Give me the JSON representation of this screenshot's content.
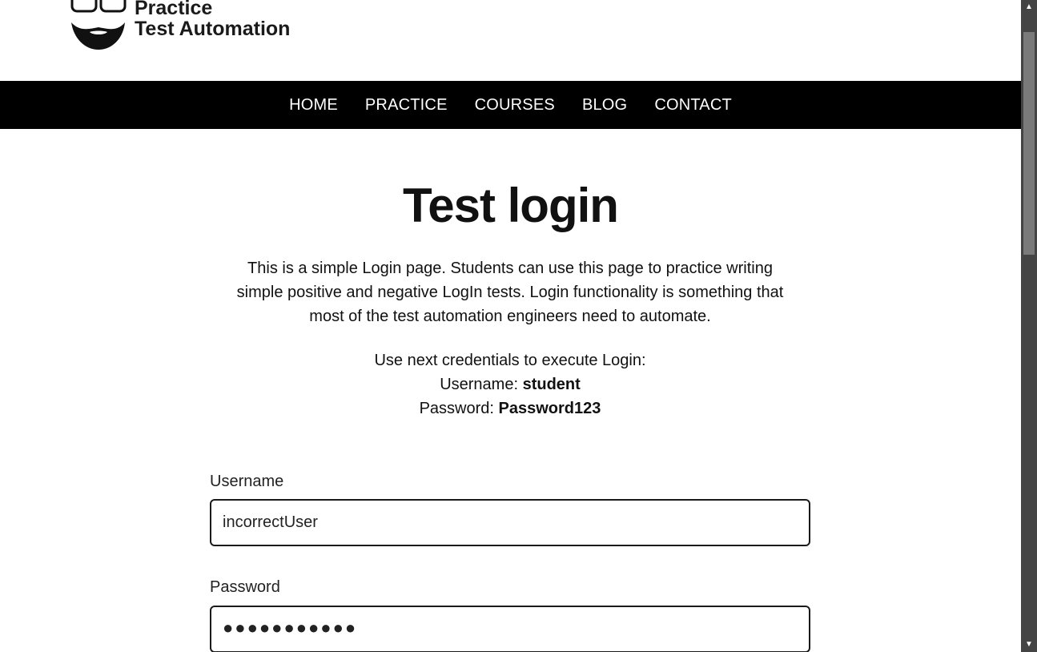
{
  "logo": {
    "line1": "Practice",
    "line2": "Test Automation",
    "icon": "bearded-face-icon"
  },
  "nav": {
    "items": [
      "HOME",
      "PRACTICE",
      "COURSES",
      "BLOG",
      "CONTACT"
    ]
  },
  "main": {
    "title": "Test login",
    "intro": "This is a simple Login page. Students can use this page to practice writing simple positive and negative LogIn tests. Login functionality is something that most of the test automation engineers need to automate.",
    "creds_heading": "Use next credentials to execute Login:",
    "username_label_inline": "Username:",
    "username_value": "student",
    "password_label_inline": "Password:",
    "password_value": "Password123"
  },
  "form": {
    "username_label": "Username",
    "username_value": "incorrectUser",
    "password_label": "Password",
    "password_masked": "●●●●●●●●●●●"
  },
  "colors": {
    "nav_bg": "#000000",
    "text": "#111111"
  }
}
